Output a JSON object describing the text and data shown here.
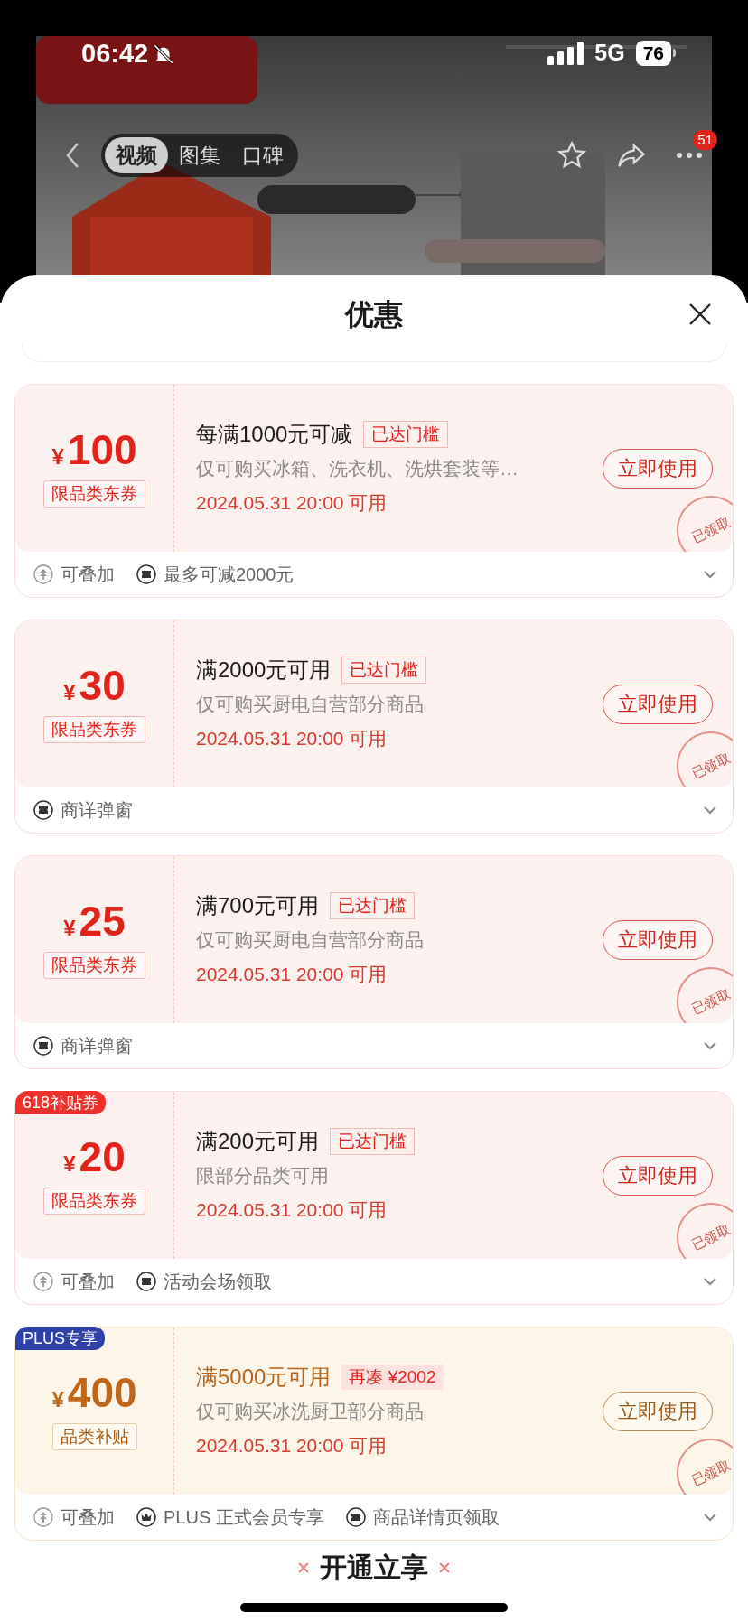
{
  "status_bar": {
    "time": "06:42",
    "network": "5G",
    "battery": "76"
  },
  "nav": {
    "tabs": [
      {
        "label": "视频",
        "selected": true
      },
      {
        "label": "图集",
        "selected": false
      },
      {
        "label": "口碑",
        "selected": false
      }
    ],
    "more_badge": "51"
  },
  "sheet": {
    "title": "优惠"
  },
  "coupons": [
    {
      "kind": "standard",
      "currency": "¥",
      "amount": "100",
      "tag": "限品类东券",
      "title": "每满1000元可减",
      "badge": {
        "kind": "reached",
        "text": "已达门槛"
      },
      "desc": "仅可购买冰箱、洗衣机、洗烘套装等…",
      "date": "2024.05.31 20:00 可用",
      "button": "立即使用",
      "stamp": "已领取",
      "footer": [
        {
          "kind": "stack",
          "text": "可叠加"
        },
        {
          "kind": "ticket",
          "text": "最多可减2000元"
        }
      ]
    },
    {
      "kind": "standard",
      "currency": "¥",
      "amount": "30",
      "tag": "限品类东券",
      "title": "满2000元可用",
      "badge": {
        "kind": "reached",
        "text": "已达门槛"
      },
      "desc": "仅可购买厨电自营部分商品",
      "date": "2024.05.31 20:00 可用",
      "button": "立即使用",
      "stamp": "已领取",
      "footer": [
        {
          "kind": "ticket",
          "text": "商详弹窗"
        }
      ]
    },
    {
      "kind": "standard",
      "currency": "¥",
      "amount": "25",
      "tag": "限品类东券",
      "title": "满700元可用",
      "badge": {
        "kind": "reached",
        "text": "已达门槛"
      },
      "desc": "仅可购买厨电自营部分商品",
      "date": "2024.05.31 20:00 可用",
      "button": "立即使用",
      "stamp": "已领取",
      "footer": [
        {
          "kind": "ticket",
          "text": "商详弹窗"
        }
      ]
    },
    {
      "kind": "standard",
      "corner_label": {
        "kind": "promo",
        "text": "618补贴券"
      },
      "currency": "¥",
      "amount": "20",
      "tag": "限品类东券",
      "title": "满200元可用",
      "badge": {
        "kind": "reached",
        "text": "已达门槛"
      },
      "desc": "限部分品类可用",
      "date": "2024.05.31 20:00 可用",
      "button": "立即使用",
      "stamp": "已领取",
      "footer": [
        {
          "kind": "stack",
          "text": "可叠加"
        },
        {
          "kind": "ticket",
          "text": "活动会场领取"
        }
      ]
    },
    {
      "kind": "plus",
      "corner_label": {
        "kind": "plus",
        "text": "PLUS专享"
      },
      "currency": "¥",
      "amount": "400",
      "tag": "品类补贴",
      "title": "满5000元可用",
      "badge": {
        "kind": "short",
        "text": "再凑 ¥2002"
      },
      "desc": "仅可购买冰洗厨卫部分商品",
      "date": "2024.05.31 20:00 可用",
      "button": "立即使用",
      "stamp": "已领取",
      "footer": [
        {
          "kind": "stack",
          "text": "可叠加"
        },
        {
          "kind": "crown",
          "text": "PLUS 正式会员专享"
        },
        {
          "kind": "ticket",
          "text": "商品详情页领取"
        }
      ]
    }
  ],
  "bottom_cta": "开通立享"
}
